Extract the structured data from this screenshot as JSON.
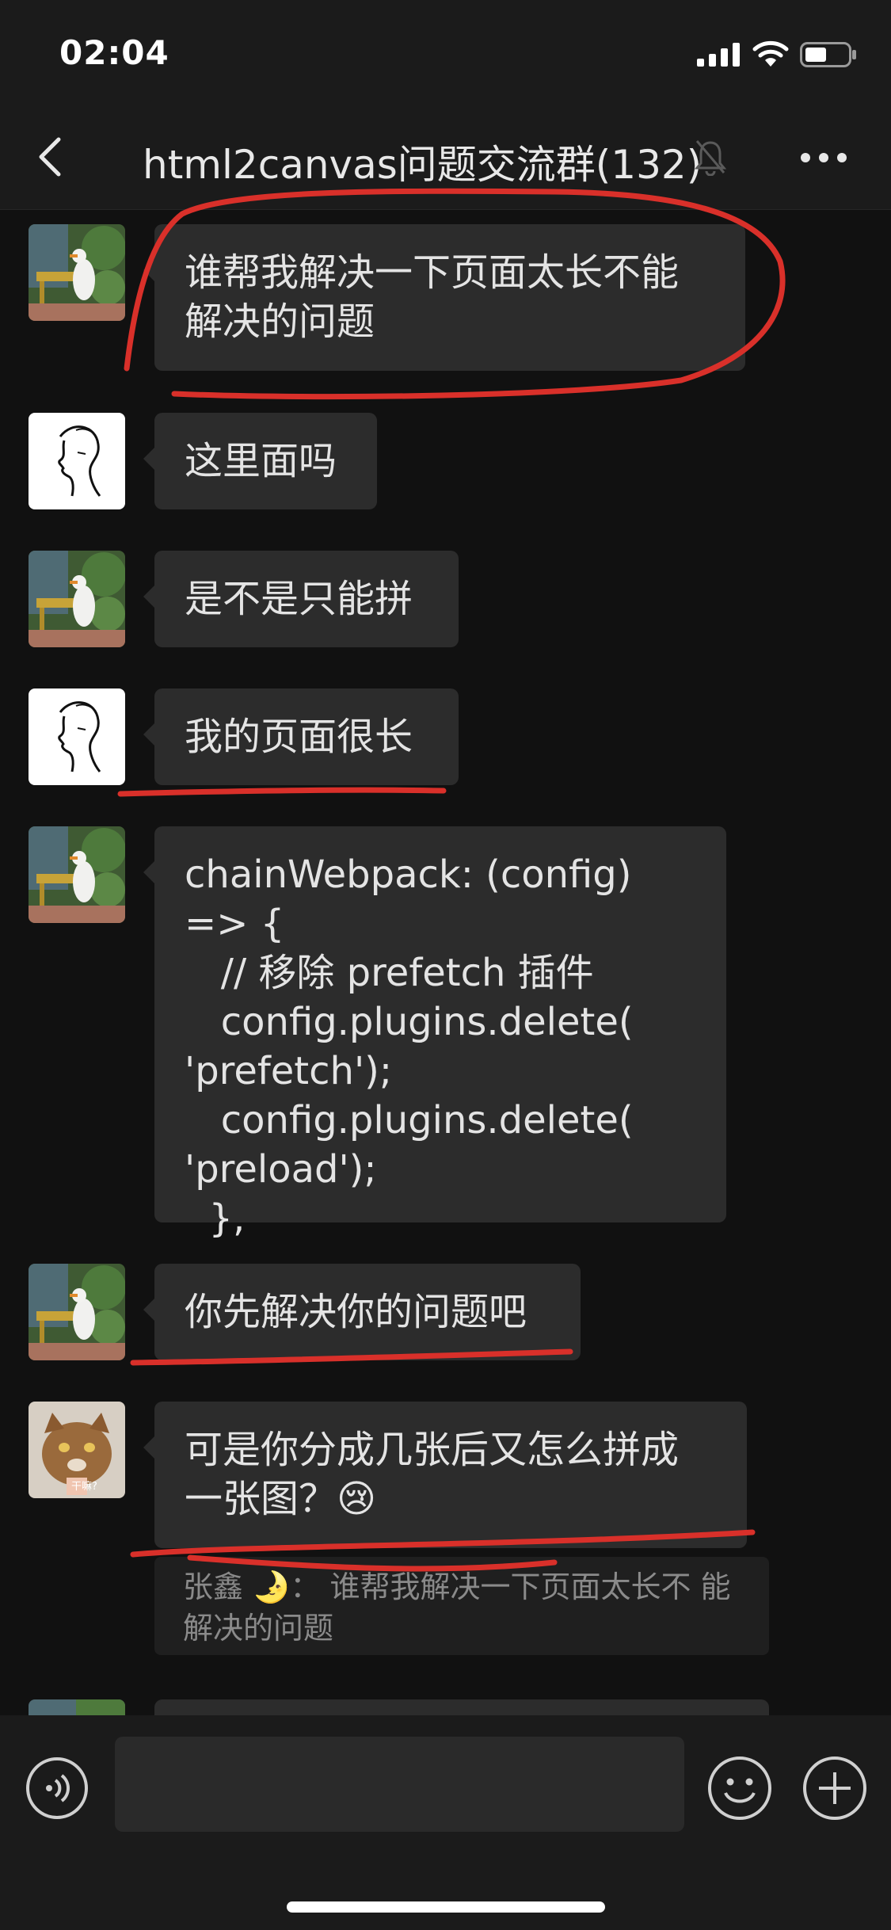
{
  "status": {
    "time": "02:04"
  },
  "nav": {
    "title": "html2canvas问题交流群(132)"
  },
  "messages": [
    {
      "text": "谁帮我解决一下页面太长不能\n解决的问题"
    },
    {
      "text": "这里面吗"
    },
    {
      "text": "是不是只能拼"
    },
    {
      "text": "我的页面很长"
    },
    {
      "text": "chainWebpack: (config) => {\n   // 移除 prefetch 插件\n   config.plugins.delete(\n'prefetch');\n   config.plugins.delete(\n'preload');\n  },"
    },
    {
      "text": "你先解决你的问题吧"
    },
    {
      "text": "可是你分成几张后又怎么拼成\n一张图？😢"
    }
  ],
  "quote": {
    "text": "张鑫 🌛： 谁帮我解决一下页面太长不\n能解决的问题"
  },
  "cat_avatar_caption": "干嘛?",
  "colors": {
    "background": "#111111",
    "bubble": "#2c2c2c",
    "annotation": "#d9302a"
  }
}
